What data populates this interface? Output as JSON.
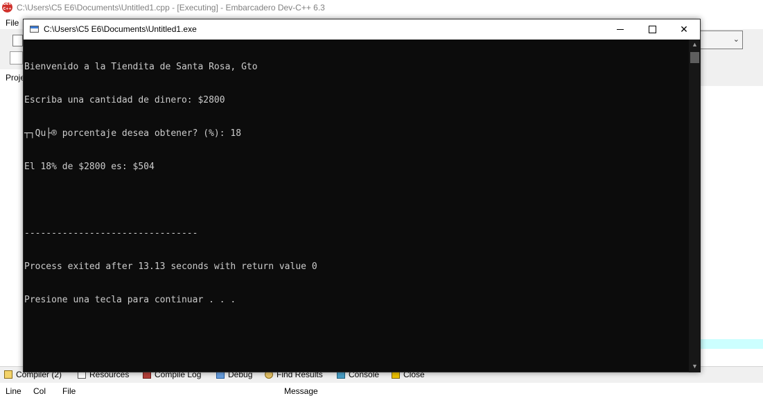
{
  "ide": {
    "window_title": "C:\\Users\\C5 E6\\Documents\\Untitled1.cpp - [Executing] - Embarcadero Dev-C++ 6.3",
    "logo_text": "DEV C++",
    "menu": {
      "file": "File"
    },
    "projects_tab": "Proje",
    "bottom_tabs": [
      {
        "label": "Compiler (2)",
        "icon": "compiler-icon"
      },
      {
        "label": "Resources",
        "icon": "resources-icon"
      },
      {
        "label": "Compile Log",
        "icon": "compile-log-icon"
      },
      {
        "label": "Debug",
        "icon": "debug-icon"
      },
      {
        "label": "Find Results",
        "icon": "find-results-icon"
      },
      {
        "label": "Console",
        "icon": "console-icon"
      },
      {
        "label": "Close",
        "icon": "close-tab-icon"
      }
    ],
    "footer_columns": [
      "Line",
      "Col",
      "File",
      "Message"
    ]
  },
  "console": {
    "title": "C:\\Users\\C5 E6\\Documents\\Untitled1.exe",
    "lines": [
      "Bienvenido a la Tiendita de Santa Rosa, Gto",
      "Escriba una cantidad de dinero: $2800",
      "┬┐Qu├® porcentaje desea obtener? (%): 18",
      "El 18% de $2800 es: $504",
      "",
      "--------------------------------",
      "Process exited after 13.13 seconds with return value 0",
      "Presione una tecla para continuar . . ."
    ]
  }
}
